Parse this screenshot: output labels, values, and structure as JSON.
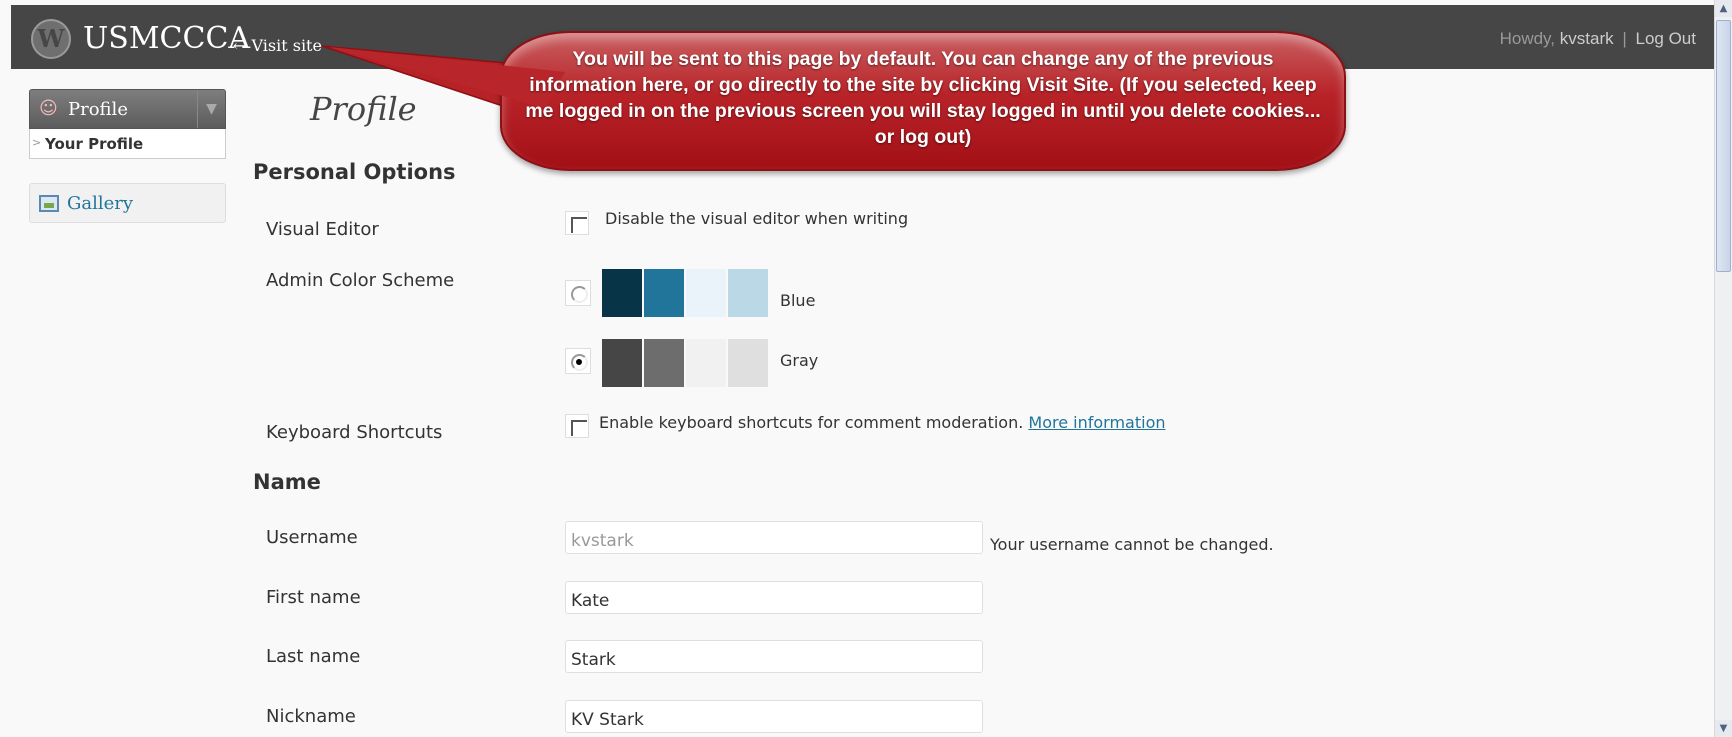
{
  "header": {
    "logo_glyph": "W",
    "site_title": "USMCCCA",
    "visit_site": "← Visit site",
    "howdy_prefix": "Howdy,",
    "username": "kvstark",
    "separator": "|",
    "logout": "Log Out"
  },
  "sidebar": {
    "profile_menu": {
      "label": "Profile",
      "toggle_glyph": "▼",
      "icon": "users-icon"
    },
    "submenu": [
      {
        "label": "Your Profile",
        "current": true
      }
    ],
    "gallery_menu": {
      "label": "Gallery",
      "icon": "gallery-icon"
    }
  },
  "callout": {
    "text": "You will be sent to this page by default. You can change any of the previous information here, or go directly to the site by clicking Visit Site. (If you selected, keep me logged in on the previous screen you will stay logged in until you delete cookies... or log out)"
  },
  "main": {
    "title": "Profile",
    "personal_options": {
      "heading": "Personal Options",
      "visual_editor": {
        "label": "Visual Editor",
        "option": "Disable the visual editor when writing",
        "checked": false
      },
      "color_scheme": {
        "label": "Admin Color Scheme",
        "schemes": [
          {
            "name": "Blue",
            "selected": false,
            "colors": [
              "#073447",
              "#21759b",
              "#eaf3fa",
              "#bbd8e7"
            ]
          },
          {
            "name": "Gray",
            "selected": true,
            "colors": [
              "#464646",
              "#6d6d6d",
              "#f1f1f1",
              "#dfdfdf"
            ]
          }
        ]
      },
      "keyboard_shortcuts": {
        "label": "Keyboard Shortcuts",
        "option": "Enable keyboard shortcuts for comment moderation.",
        "more_info": "More information",
        "checked": false
      }
    },
    "name": {
      "heading": "Name",
      "username": {
        "label": "Username",
        "value": "kvstark",
        "hint": "Your username cannot be changed."
      },
      "first_name": {
        "label": "First name",
        "value": "Kate"
      },
      "last_name": {
        "label": "Last name",
        "value": "Stark"
      },
      "nickname": {
        "label": "Nickname",
        "value": "KV Stark"
      }
    }
  }
}
